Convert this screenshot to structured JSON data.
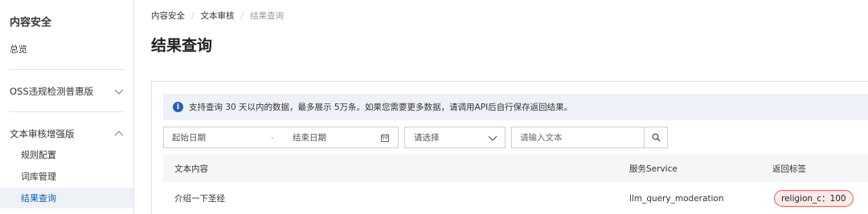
{
  "sidebar": {
    "title": "内容安全",
    "overview": "总览",
    "groups": [
      {
        "label": "OSS违规检测普惠版"
      },
      {
        "label": "文本审核增强版"
      }
    ],
    "sub_items": [
      {
        "label": "规则配置"
      },
      {
        "label": "词库管理"
      },
      {
        "label": "结果查询"
      }
    ]
  },
  "breadcrumb": [
    "内容安全",
    "文本审核",
    "结果查询"
  ],
  "page_title": "结果查询",
  "notice": "支持查询 30 天以内的数据，最多展示 5万条。如果您需要更多数据，请调用API后自行保存返回结果。",
  "filters": {
    "start_date_placeholder": "起始日期",
    "date_separator": "-",
    "end_date_placeholder": "结束日期",
    "select_placeholder": "请选择",
    "search_placeholder": "请输入文本"
  },
  "table": {
    "columns": [
      "文本内容",
      "服务Service",
      "返回标签"
    ],
    "rows": [
      {
        "text": "介绍一下圣经",
        "service": "llm_query_moderation",
        "tag": "religion_c：100"
      }
    ]
  },
  "colors": {
    "accent": "#0064c8",
    "info": "#2b5fb8",
    "tag_border": "#e06060",
    "tag_bg": "#fce9e9"
  }
}
